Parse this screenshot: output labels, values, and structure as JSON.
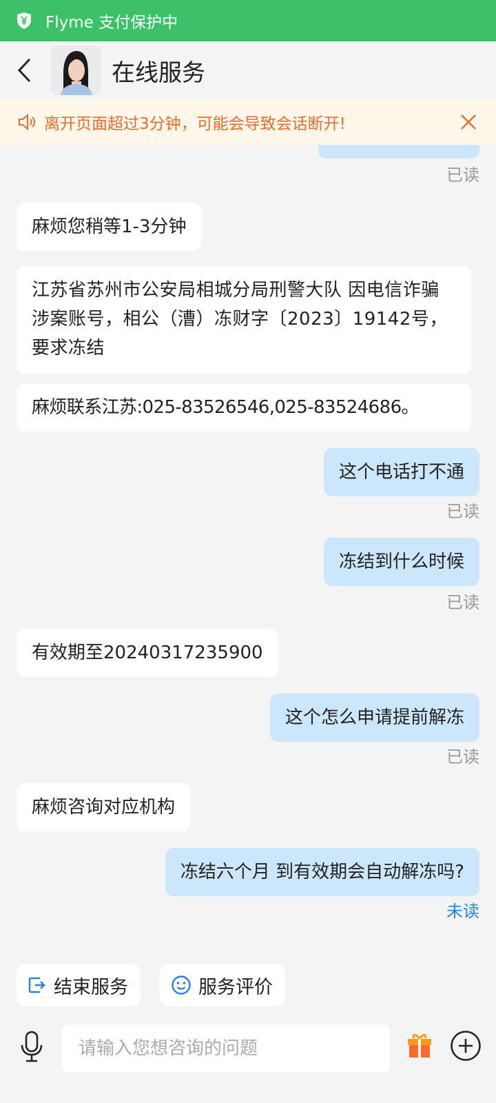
{
  "status_bar": {
    "title": "Flyme 支付保护中",
    "color": "#3cc068"
  },
  "header": {
    "title": "在线服务"
  },
  "notice": {
    "text": "离开页面超过3分钟，可能会导致会话断开!",
    "color": "#ef6a2a"
  },
  "messages": [
    {
      "side": "out",
      "text": "",
      "receipt": "已读"
    },
    {
      "side": "in",
      "text": "麻烦您稍等1-3分钟"
    },
    {
      "side": "in",
      "text": "江苏省苏州市公安局相城分局刑警大队 因电信诈骗涉案账号，相公（漕）冻财字〔2023〕19142号，要求冻结"
    },
    {
      "side": "in",
      "text": "麻烦联系江苏:025-83526546,025-83524686。"
    },
    {
      "side": "out",
      "text": "这个电话打不通",
      "receipt": "已读"
    },
    {
      "side": "out",
      "text": "冻结到什么时候",
      "receipt": "已读"
    },
    {
      "side": "in",
      "text": "有效期至20240317235900"
    },
    {
      "side": "out",
      "text": "这个怎么申请提前解冻",
      "receipt": "已读"
    },
    {
      "side": "in",
      "text": "麻烦咨询对应机构"
    },
    {
      "side": "out",
      "text": "冻结六个月 到有效期会自动解冻吗?",
      "receipt": "未读"
    }
  ],
  "quick_actions": [
    {
      "label": "结束服务",
      "icon": "exit-icon"
    },
    {
      "label": "服务评价",
      "icon": "smiley-icon"
    }
  ],
  "input": {
    "placeholder": "请输入您想咨询的问题",
    "value": ""
  },
  "colors": {
    "accent_blue": "#2b7fe0",
    "bubble_out": "#cce6fb",
    "gift_orange": "#ff6a2c"
  }
}
